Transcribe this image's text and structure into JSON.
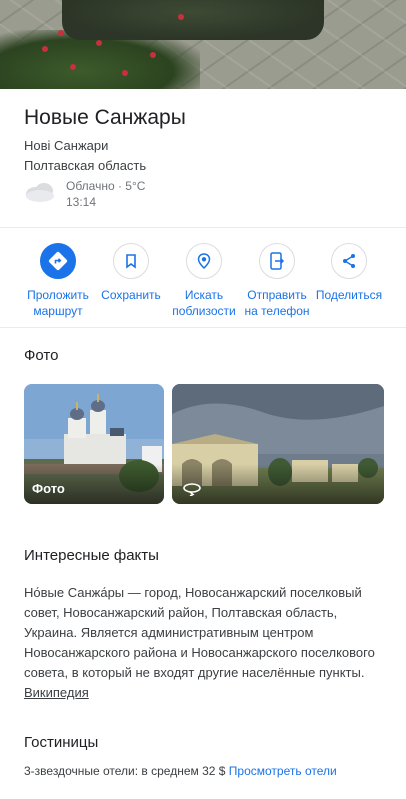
{
  "place": {
    "title": "Новые Санжары",
    "alt_name": "Нові Санжари",
    "region": "Полтавская область"
  },
  "weather": {
    "condition": "Облачно · 5°C",
    "time": "13:14",
    "icon": "cloud-icon"
  },
  "actions": [
    {
      "label": "Проложить маршрут",
      "icon": "directions-icon"
    },
    {
      "label": "Сохранить",
      "icon": "bookmark-icon"
    },
    {
      "label": "Искать поблизости",
      "icon": "nearby-icon"
    },
    {
      "label": "Отправить на телефон",
      "icon": "send-to-phone-icon"
    },
    {
      "label": "Поделиться",
      "icon": "share-icon"
    }
  ],
  "photos": {
    "title": "Фото",
    "items": [
      {
        "caption": "Фото"
      },
      {
        "caption": "",
        "icon": "360-icon"
      }
    ]
  },
  "facts": {
    "title": "Интересные факты",
    "text": "Но́вые Санжа́ры — город, Новосанжарский поселковый совет, Новосанжарский район, Полтавская область, Украина. Является административным центром Новосанжарского района и Новосанжарского поселкового совета, в который не входят другие населённые пункты.",
    "source": "Википедия"
  },
  "hotels": {
    "title": "Гостиницы",
    "summary": "3-звездочные отели: в среднем 32 $",
    "link": "Просмотреть отели"
  },
  "colors": {
    "accent": "#1a73e8",
    "text": "#202124",
    "secondary": "#70757a"
  }
}
